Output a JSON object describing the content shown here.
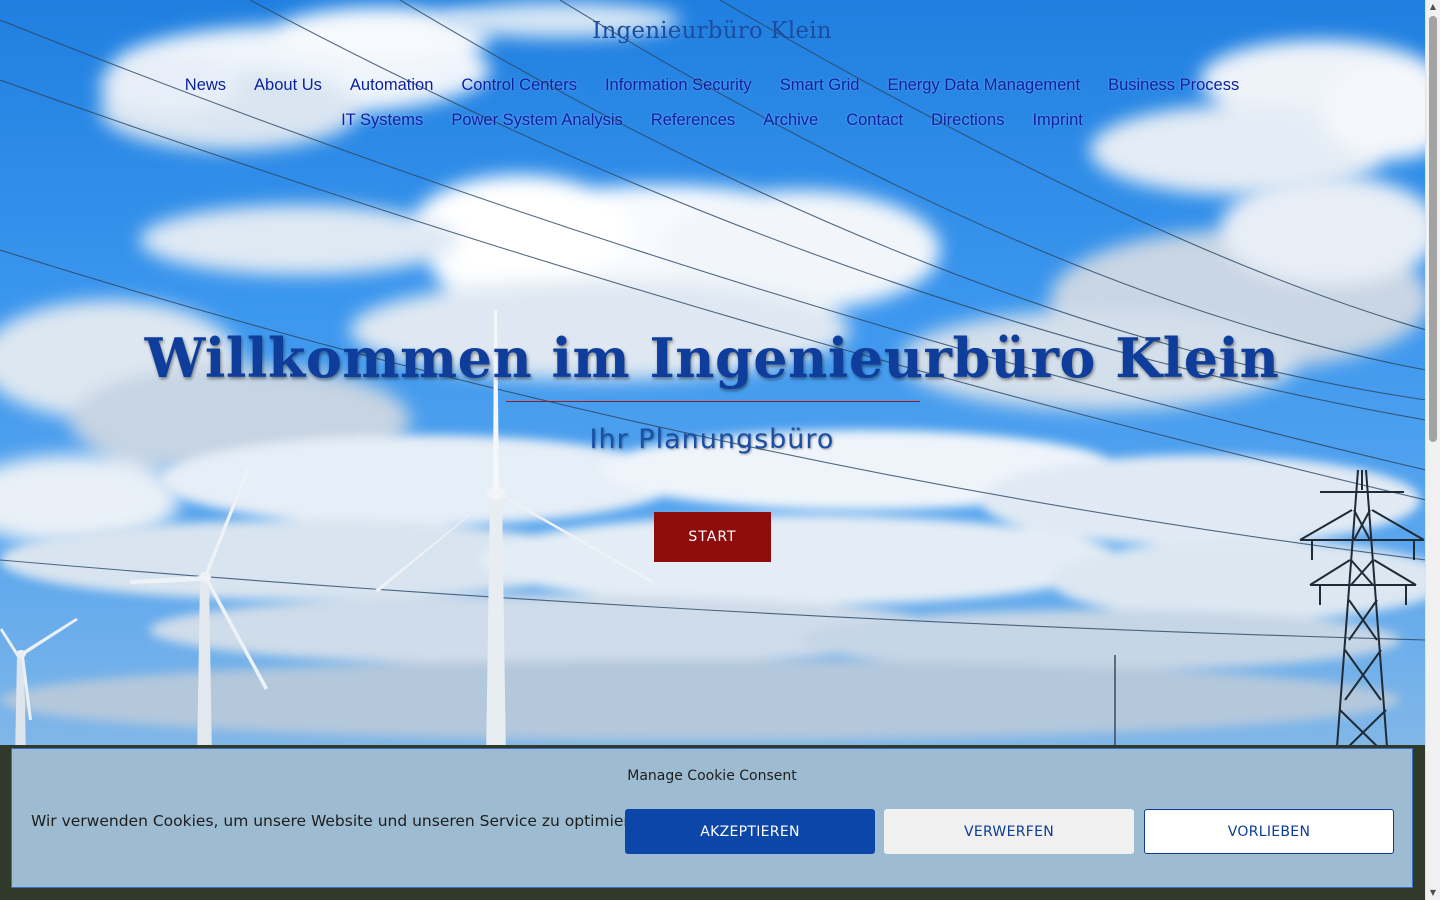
{
  "site": {
    "title": "Ingenieurbüro Klein"
  },
  "nav": {
    "row1": [
      "News",
      "About Us",
      "Automation",
      "Control Centers",
      "Information Security",
      "Smart Grid",
      "Energy Data Management",
      "Business Process"
    ],
    "row2": [
      "IT Systems",
      "Power System Analysis",
      "References",
      "Archive",
      "Contact",
      "Directions",
      "Imprint"
    ]
  },
  "hero": {
    "title": "Willkommen im Ingenieurbüro Klein",
    "subtitle": "Ihr Planungsbüro",
    "start_label": "START"
  },
  "cookie": {
    "title": "Manage Cookie Consent",
    "text": "Wir verwenden Cookies, um unsere Website und unseren Service zu optimieren.",
    "accept_label": "AKZEPTIEREN",
    "deny_label": "VERWERFEN",
    "prefs_label": "VORLIEBEN"
  },
  "colors": {
    "accent": "#0b46a8",
    "start_button": "#8e0c0c",
    "nav_link": "#0b1fa3",
    "banner_bg": "#9dbbd1"
  }
}
